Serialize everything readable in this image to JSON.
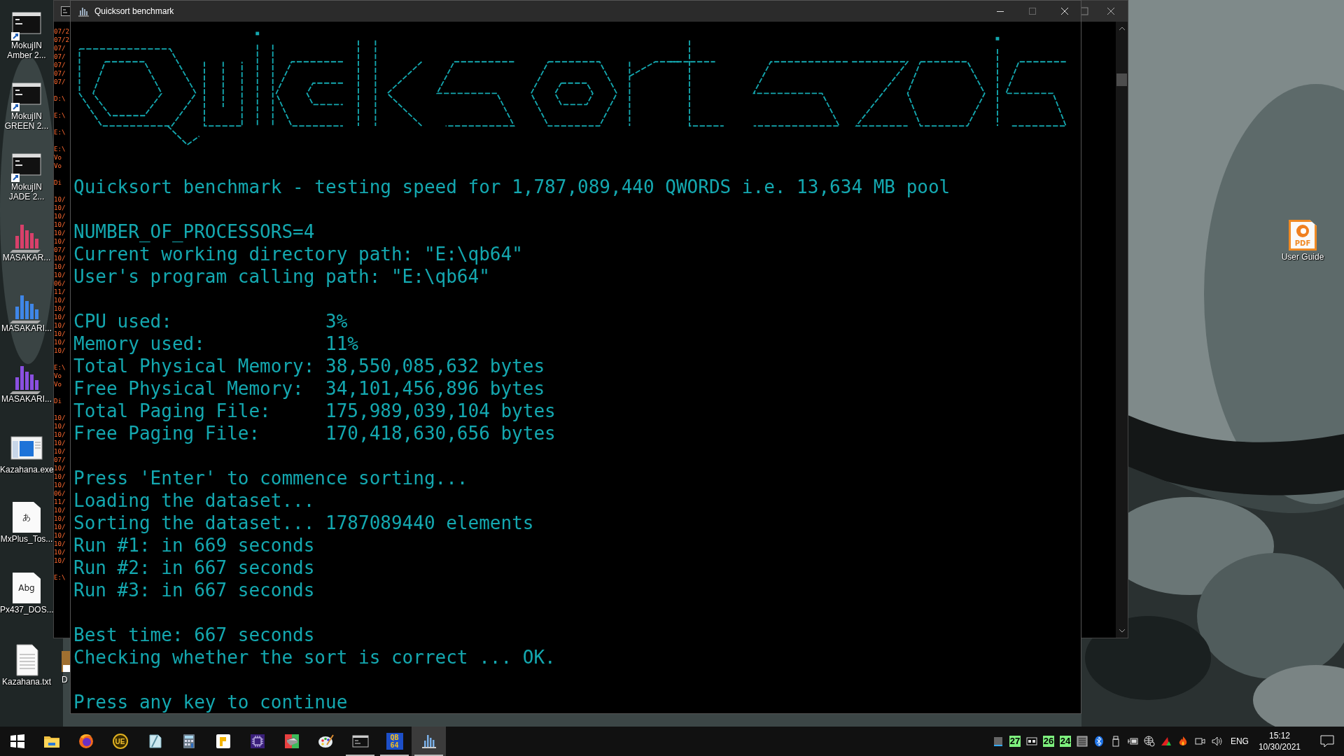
{
  "desktop": {
    "left_icons": [
      {
        "label": "MokujIN Amber 2...",
        "kind": "console"
      },
      {
        "label": "MokujIN GREEN 2...",
        "kind": "console"
      },
      {
        "label": "MokujIN JADE 2...",
        "kind": "console"
      },
      {
        "label": "MASAKAR...",
        "kind": "chart",
        "color": "#d8406a"
      },
      {
        "label": "MASAKARI...",
        "kind": "chart",
        "color": "#3f86e8"
      },
      {
        "label": "MASAKARI...",
        "kind": "chart",
        "color": "#8a4fe0"
      },
      {
        "label": "Kazahana.exe",
        "kind": "app"
      },
      {
        "label": "MxPlus_Tos...",
        "kind": "font",
        "glyph": "あ"
      },
      {
        "label": "Px437_DOS...",
        "kind": "font",
        "glyph": "Abg"
      },
      {
        "label": "Kazahana.txt",
        "kind": "text"
      }
    ],
    "hidden_icon": {
      "label": "D"
    },
    "right_icons": [
      {
        "label": "User Guide",
        "kind": "pdf",
        "glyph": "PDF"
      }
    ]
  },
  "background_window": {
    "log_blocks": [
      [
        "07/2",
        "07/2",
        "07/",
        "07/",
        "07/",
        "07/",
        "07/"
      ],
      [
        "D:\\"
      ],
      [
        "E:\\"
      ],
      [
        "E:\\"
      ],
      [
        "E:\\",
        "Vo",
        "Vo"
      ],
      [
        "Di"
      ],
      [
        "10/",
        "10/",
        "10/",
        "10/",
        "10/",
        "10/",
        "07/",
        "10/",
        "10/",
        "10/",
        "06/",
        "11/",
        "10/",
        "10/",
        "10/",
        "10/",
        "10/",
        "10/",
        "10/"
      ],
      [
        "E:\\",
        "Vo",
        "Vo"
      ],
      [
        "Di"
      ],
      [
        "10/",
        "10/",
        "10/",
        "10/",
        "10/",
        "07/",
        "10/",
        "10/",
        "10/",
        "06/",
        "11/",
        "10/",
        "10/",
        "10/",
        "10/",
        "10/",
        "10/",
        "10/"
      ],
      [
        "E:\\"
      ]
    ]
  },
  "window": {
    "title": "Quicksort benchmark",
    "console": {
      "header": "Quicksort benchmark - testing speed for 1,787,089,440 QWORDS i.e. 13,634 MB pool",
      "environment": [
        "NUMBER_OF_PROCESSORS=4",
        "Current working directory path: \"E:\\qb64\"",
        "User's program calling path: \"E:\\qb64\""
      ],
      "stats": [
        {
          "label": "CPU used:",
          "value": "3%"
        },
        {
          "label": "Memory used:",
          "value": "11%"
        },
        {
          "label": "Total Physical Memory:",
          "value": "38,550,085,632 bytes"
        },
        {
          "label": "Free Physical Memory:",
          "value": "34,101,456,896 bytes"
        },
        {
          "label": "Total Paging File:",
          "value": "175,989,039,104 bytes"
        },
        {
          "label": "Free Paging File:",
          "value": "170,418,630,656 bytes"
        }
      ],
      "progress": [
        "Press 'Enter' to commence sorting...",
        "Loading the dataset...",
        "Sorting the dataset... 1787089440 elements",
        "Run #1: in 669 seconds",
        "Run #2: in 667 seconds",
        "Run #3: in 667 seconds"
      ],
      "results": [
        "Best time: 667 seconds",
        "Checking whether the sort is correct ... OK."
      ],
      "prompt": "Press any key to continue"
    }
  },
  "taskbar": {
    "apps": [
      {
        "kind": "start",
        "running": false,
        "selected": false
      },
      {
        "kind": "folder",
        "running": false,
        "selected": false
      },
      {
        "kind": "browser",
        "running": false,
        "selected": false
      },
      {
        "kind": "editor",
        "glyph": "UE",
        "running": false,
        "selected": false
      },
      {
        "kind": "notepad",
        "running": false,
        "selected": false
      },
      {
        "kind": "calculator",
        "running": false,
        "selected": false
      },
      {
        "kind": "ptile",
        "running": false,
        "selected": false
      },
      {
        "kind": "chip",
        "running": false,
        "selected": false
      },
      {
        "kind": "drive",
        "running": false,
        "selected": false
      },
      {
        "kind": "palette",
        "running": false,
        "selected": false
      },
      {
        "kind": "console",
        "running": true,
        "selected": false
      },
      {
        "kind": "qb",
        "glyphs": [
          "QB",
          "64"
        ],
        "running": true,
        "selected": false
      },
      {
        "kind": "chart",
        "running": true,
        "selected": true
      }
    ],
    "tray": [
      {
        "kind": "meter"
      },
      {
        "kind": "badge",
        "text": "27"
      },
      {
        "kind": "tape"
      },
      {
        "kind": "badge",
        "text": "26"
      },
      {
        "kind": "badge",
        "text": "24"
      },
      {
        "kind": "grid"
      },
      {
        "kind": "bluetooth"
      },
      {
        "kind": "usb"
      },
      {
        "kind": "power"
      },
      {
        "kind": "globe"
      },
      {
        "kind": "triangle"
      },
      {
        "kind": "fire"
      },
      {
        "kind": "camera"
      },
      {
        "kind": "volume"
      }
    ],
    "language": "ENG",
    "time": "15:12",
    "date": "10/30/2021"
  }
}
